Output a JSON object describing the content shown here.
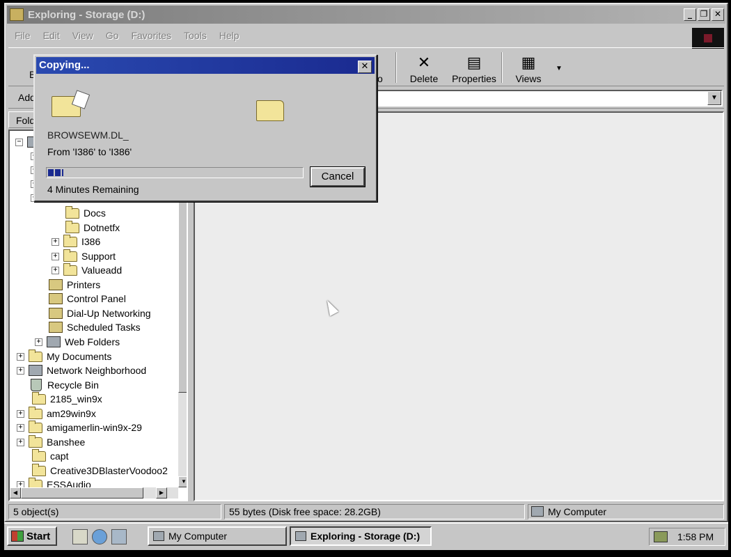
{
  "window": {
    "title": "Exploring - Storage (D:)",
    "minimize": "_",
    "maximize": "❐",
    "close": "✕"
  },
  "menu": [
    "File",
    "Edit",
    "View",
    "Go",
    "Favorites",
    "Tools",
    "Help"
  ],
  "toolbar": {
    "back_partial": "B",
    "delete": "Delete",
    "properties": "Properties",
    "views": "Views",
    "partial_label": "o"
  },
  "address": {
    "label": "Add",
    "value": ""
  },
  "folders_header": "Folde",
  "tree": [
    {
      "label": "Docs",
      "expander": ""
    },
    {
      "label": "Dotnetfx",
      "expander": ""
    },
    {
      "label": "I386",
      "expander": "+"
    },
    {
      "label": "Support",
      "expander": "+"
    },
    {
      "label": "Valueadd",
      "expander": "+"
    },
    {
      "label": "Printers"
    },
    {
      "label": "Control Panel"
    },
    {
      "label": "Dial-Up Networking"
    },
    {
      "label": "Scheduled Tasks"
    },
    {
      "label": "Web Folders",
      "expander": "+"
    },
    {
      "label": "My Documents",
      "expander": "+"
    },
    {
      "label": "Network Neighborhood",
      "expander": "+"
    },
    {
      "label": "Recycle Bin"
    },
    {
      "label": "2185_win9x"
    },
    {
      "label": "am29win9x",
      "expander": "+"
    },
    {
      "label": "amigamerlin-win9x-29",
      "expander": "+"
    },
    {
      "label": "Banshee",
      "expander": "+"
    },
    {
      "label": "capt"
    },
    {
      "label": "Creative3DBlasterVoodoo2"
    },
    {
      "label": "ESSAudio",
      "expander": "+"
    }
  ],
  "status": {
    "objects": "5 object(s)",
    "size": "55 bytes (Disk free space: 28.2GB)",
    "location": "My Computer"
  },
  "taskbar": {
    "start": "Start",
    "tasks": [
      "My Computer",
      "Exploring - Storage (D:)"
    ],
    "clock": "1:58 PM"
  },
  "dialog": {
    "title": "Copying...",
    "close": "✕",
    "filename": "BROWSEWM.DL_",
    "from_to": "From 'I386' to 'I386'",
    "progress_fraction": 0.06,
    "cancel": "Cancel",
    "remaining": "4 Minutes Remaining"
  }
}
